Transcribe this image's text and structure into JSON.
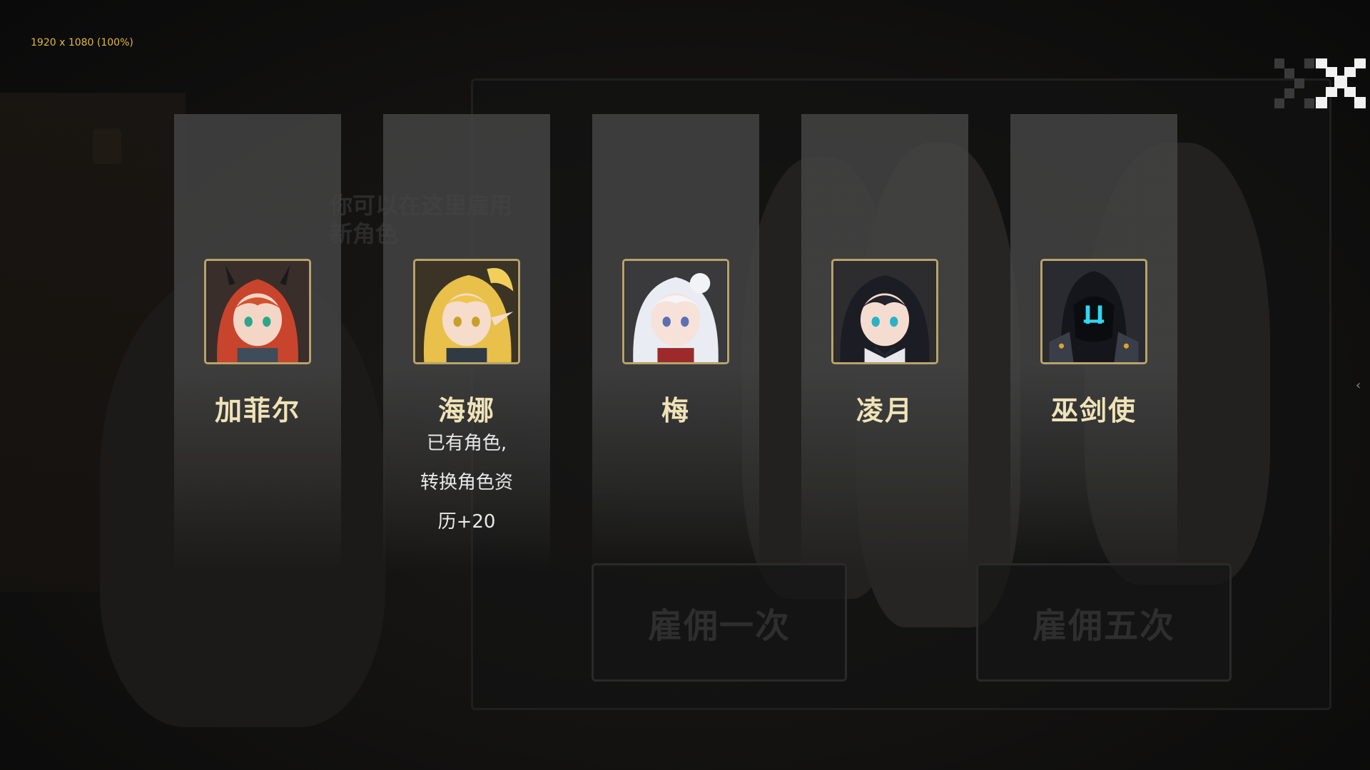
{
  "overlay": {
    "resolution_label": "1920 x 1080 (100%)"
  },
  "background": {
    "hint_text": "你可以在这里雇用新角色",
    "hire_once_label": "雇佣一次",
    "hire_five_label": "雇佣五次"
  },
  "cards": [
    {
      "name": "加菲尔",
      "note": "",
      "portrait_icon": "red-haired-horned-girl-portrait"
    },
    {
      "name": "海娜",
      "note_lines": [
        "已有角色,",
        "转换角色资",
        "历+20"
      ],
      "portrait_icon": "blonde-elf-girl-portrait"
    },
    {
      "name": "梅",
      "note": "",
      "portrait_icon": "white-haired-girl-portrait"
    },
    {
      "name": "凌月",
      "note": "",
      "portrait_icon": "black-haired-sailor-girl-portrait"
    },
    {
      "name": "巫剑使",
      "note": "",
      "portrait_icon": "hooded-armored-figure-portrait"
    }
  ],
  "controls": {
    "close_icon": "close-x-icon",
    "edge_arrow_icon": "chevron-left-icon"
  },
  "colors": {
    "frame_gold": "#b8a36a",
    "name_text": "#efe3b8",
    "resolution_text": "#e2b93b"
  }
}
